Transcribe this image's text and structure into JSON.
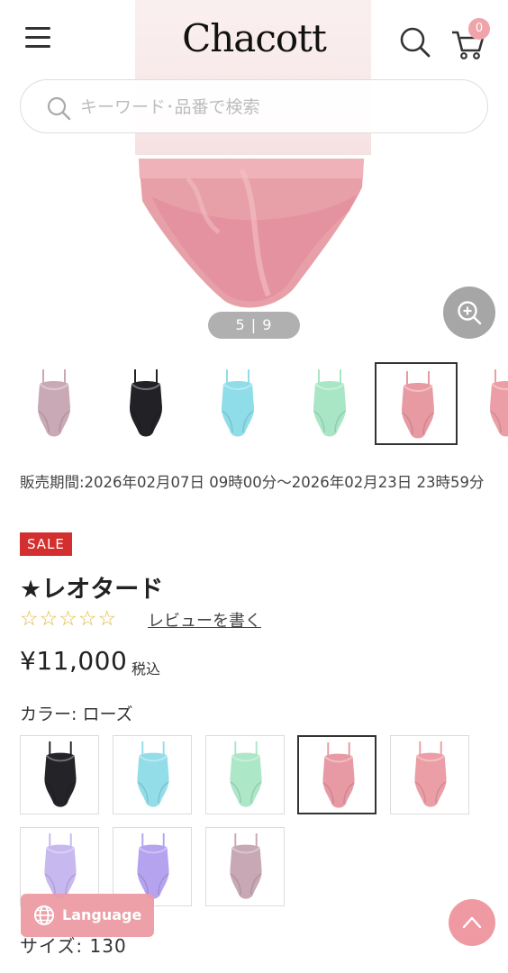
{
  "header": {
    "logo": "Chacott",
    "cart_count": "0"
  },
  "search": {
    "placeholder": "キーワード･品番で検索"
  },
  "gallery": {
    "counter": "5 | 9",
    "thumbnails": [
      {
        "color": "#c9a9b6"
      },
      {
        "color": "#222226"
      },
      {
        "color": "#8fdde8"
      },
      {
        "color": "#a9e6c6"
      },
      {
        "color": "#e89aa3",
        "selected": true
      },
      {
        "color": "#ec9ea6"
      }
    ]
  },
  "product": {
    "sale_period": "販売期間:2026年02月07日 09時00分～2026年02月23日 23時59分",
    "sale_badge": "SALE",
    "title": "★レオタード",
    "stars": "☆☆☆☆☆",
    "review_link": "レビューを書く",
    "price": "¥11,000",
    "tax_label": "税込",
    "color_label": "カラー: ローズ",
    "size_label": "サイズ: 130"
  },
  "swatches": [
    {
      "color": "#232328"
    },
    {
      "color": "#93dde9"
    },
    {
      "color": "#ace7c8"
    },
    {
      "color": "#e79aa4",
      "selected": true
    },
    {
      "color": "#ec9ea6"
    },
    {
      "color": "#c7b8ef"
    },
    {
      "color": "#b5a3f0"
    },
    {
      "color": "#c8a8b4"
    }
  ],
  "floating": {
    "language_label": "Language"
  }
}
